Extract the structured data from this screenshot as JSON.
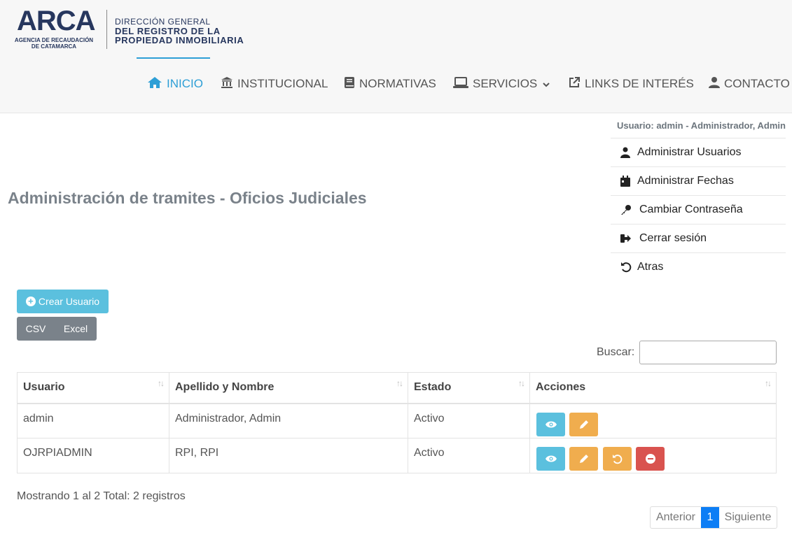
{
  "logo": {
    "brand": "ARCA",
    "sub1": "AGENCIA DE RECAUDACIÓN",
    "sub2": "DE CATAMARCA",
    "dg1": "DIRECCIÓN GENERAL",
    "dg2": "DEL REGISTRO DE LA",
    "dg3": "PROPIEDAD INMOBILIARIA"
  },
  "nav": {
    "items": [
      {
        "label": "INICIO",
        "icon": "home-icon"
      },
      {
        "label": "INSTITUCIONAL",
        "icon": "bank-icon"
      },
      {
        "label": "NORMATIVAS",
        "icon": "book-icon"
      },
      {
        "label": "SERVICIOS",
        "icon": "laptop-icon"
      },
      {
        "label": "LINKS DE INTERÉS",
        "icon": "external-link-icon"
      },
      {
        "label": "CONTACTO",
        "icon": "user-icon"
      }
    ],
    "active_color": "#2e9fd6"
  },
  "user": {
    "line": "Usuario: admin - Administrador, Admin"
  },
  "side_menu": [
    {
      "label": "Administrar Usuarios",
      "icon": "user-icon"
    },
    {
      "label": "Administrar Fechas",
      "icon": "calendar-icon"
    },
    {
      "label": "Cambiar Contraseña",
      "icon": "key-icon"
    },
    {
      "label": "Cerrar sesión",
      "icon": "sign-out-icon"
    },
    {
      "label": "Atras",
      "icon": "undo-icon"
    }
  ],
  "page": {
    "title": "Administración de tramites - Oficios Judiciales"
  },
  "toolbar": {
    "create_label": "Crear Usuario",
    "csv_label": "CSV",
    "excel_label": "Excel",
    "search_label": "Buscar:",
    "search_value": ""
  },
  "table": {
    "headers": [
      "Usuario",
      "Apellido y Nombre",
      "Estado",
      "Acciones"
    ],
    "rows": [
      {
        "usuario": "admin",
        "nombre": "Administrador, Admin",
        "estado": "Activo"
      },
      {
        "usuario": "OJRPIADMIN",
        "nombre": "RPI, RPI",
        "estado": "Activo"
      }
    ]
  },
  "footer": {
    "info": "Mostrando 1 al 2 Total: 2 registros",
    "prev": "Anterior",
    "current": "1",
    "next": "Siguiente"
  },
  "colors": {
    "info": "#5bc0de",
    "warning": "#f0ad4e",
    "danger": "#d9534f",
    "primary": "#0d7ef5",
    "secondary": "#7a828a"
  }
}
